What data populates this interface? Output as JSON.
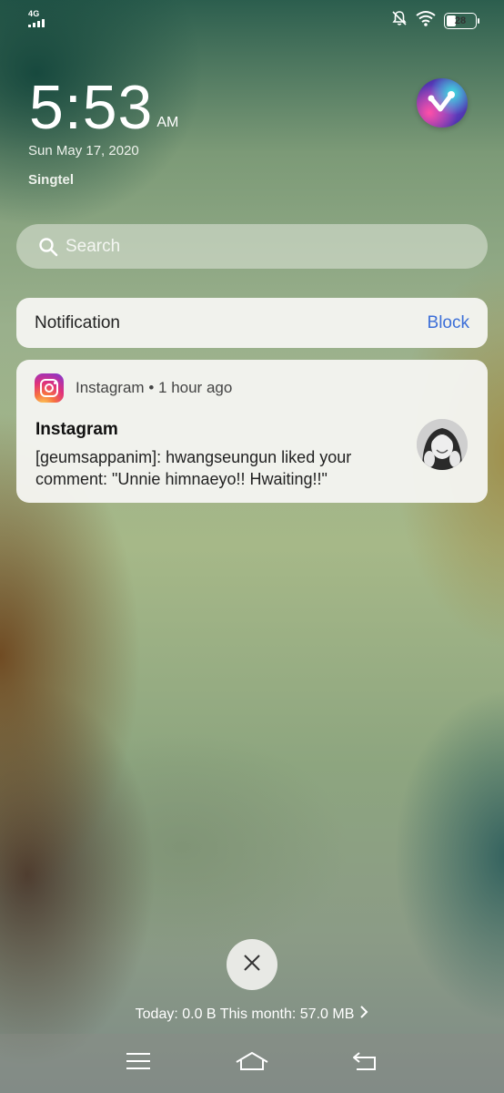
{
  "status_bar": {
    "network": "4G",
    "battery": "28",
    "battery_fraction": 0.28,
    "icons": [
      "silent-bell-icon",
      "wifi-icon",
      "battery-icon"
    ]
  },
  "lock_screen": {
    "time": "5:53",
    "ampm": "AM",
    "date": "Sun May 17, 2020",
    "carrier": "Singtel"
  },
  "search": {
    "placeholder": "Search"
  },
  "notification_header": {
    "title": "Notification",
    "action": "Block"
  },
  "notification": {
    "app": "Instagram",
    "time": "1 hour ago",
    "title": "Instagram",
    "body": "[geumsappanim]: hwangseungun liked your comment: \"Unnie himnaeyo!! Hwaiting!!\""
  },
  "footer": {
    "data_usage": "Today: 0.0 B This month: 57.0 MB"
  },
  "colors": {
    "accent": "#3c6fd8",
    "card_bg": "#f6f6f2"
  }
}
